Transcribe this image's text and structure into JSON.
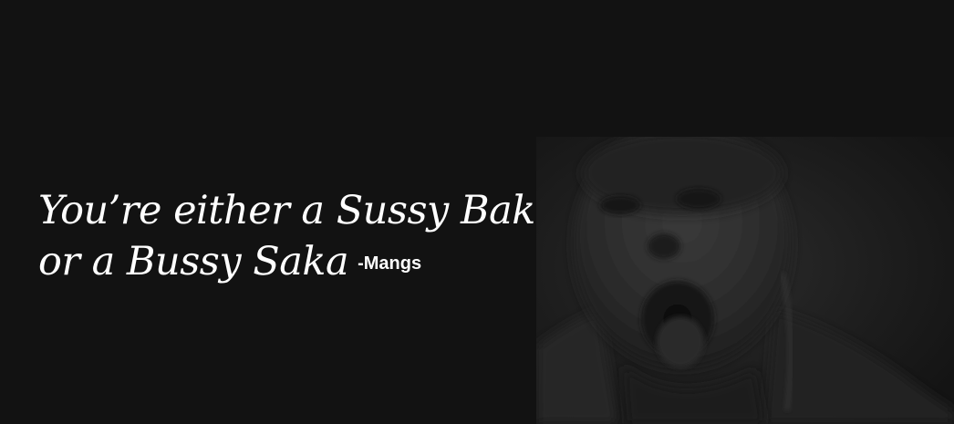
{
  "quote": {
    "line1": "You’re either a Sussy Baka",
    "line2": "or a Bussy Saka",
    "attribution": "-Mangs"
  },
  "photo": {
    "subject": "dark-screaming-face-photo"
  },
  "colors": {
    "background": "#121212",
    "text": "#ffffff"
  }
}
